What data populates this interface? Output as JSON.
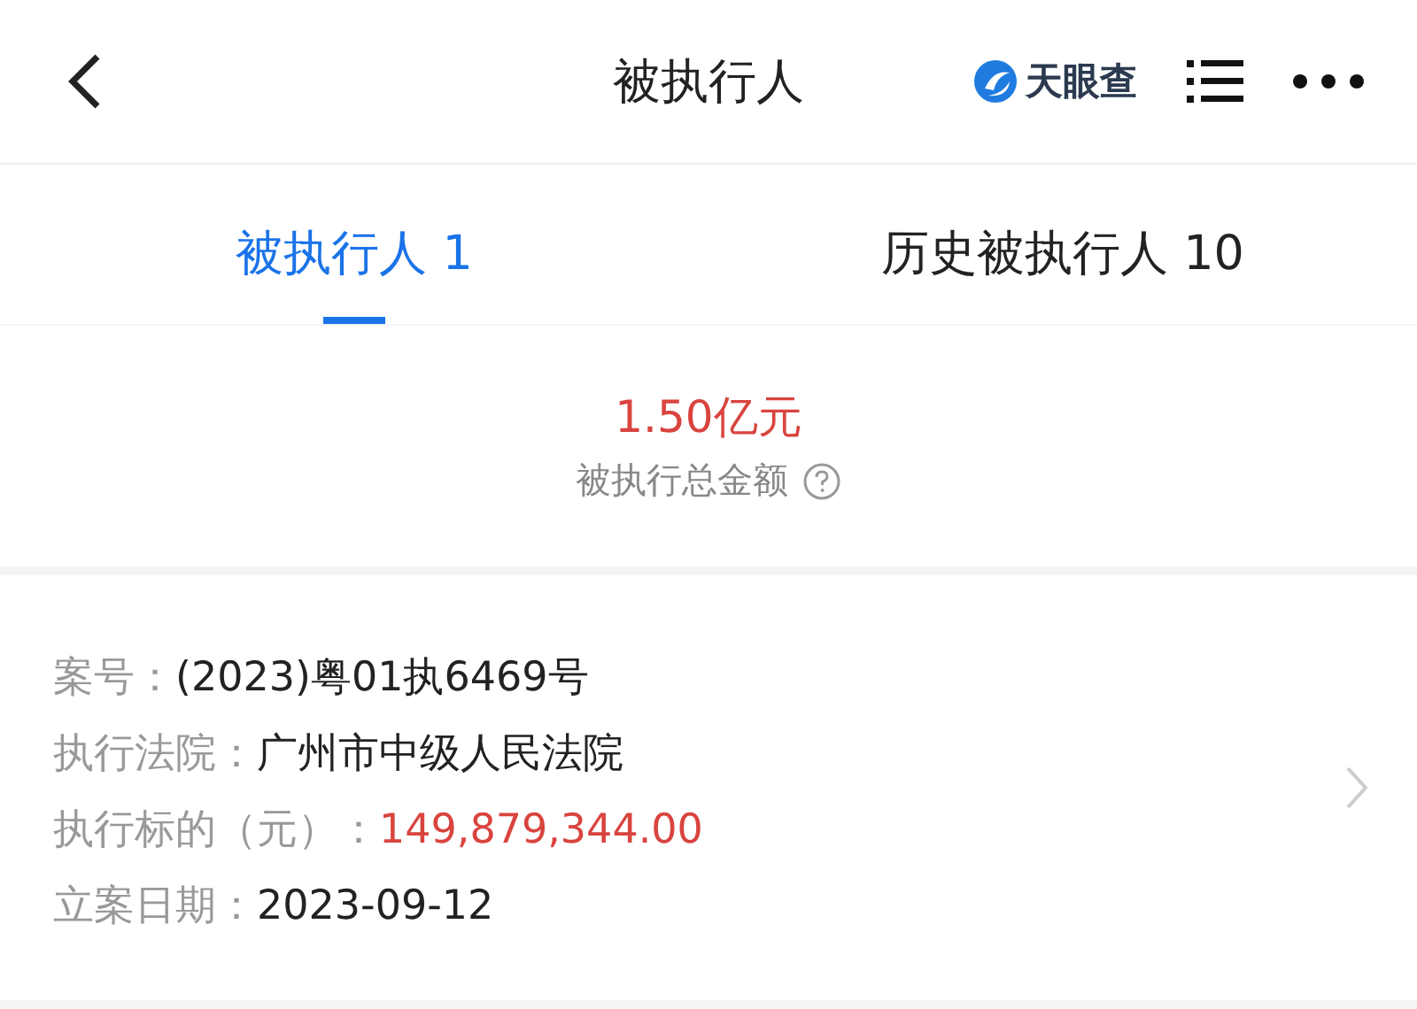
{
  "header": {
    "title": "被执行人",
    "logo_text": "天眼查"
  },
  "tabs": [
    {
      "label": "被执行人",
      "count": "1",
      "selected": true
    },
    {
      "label": "历史被执行人",
      "count": "10",
      "selected": false
    }
  ],
  "summary": {
    "amount": "1.50亿元",
    "label": "被执行总金额"
  },
  "record": {
    "fields": [
      {
        "label": "案号：",
        "value": "(2023)粤01执6469号",
        "highlight": false
      },
      {
        "label": "执行法院：",
        "value": "广州市中级人民法院",
        "highlight": false
      },
      {
        "label": "执行标的（元）：",
        "value": "149,879,344.00",
        "highlight": true
      },
      {
        "label": "立案日期：",
        "value": "2023-09-12",
        "highlight": false
      }
    ]
  }
}
